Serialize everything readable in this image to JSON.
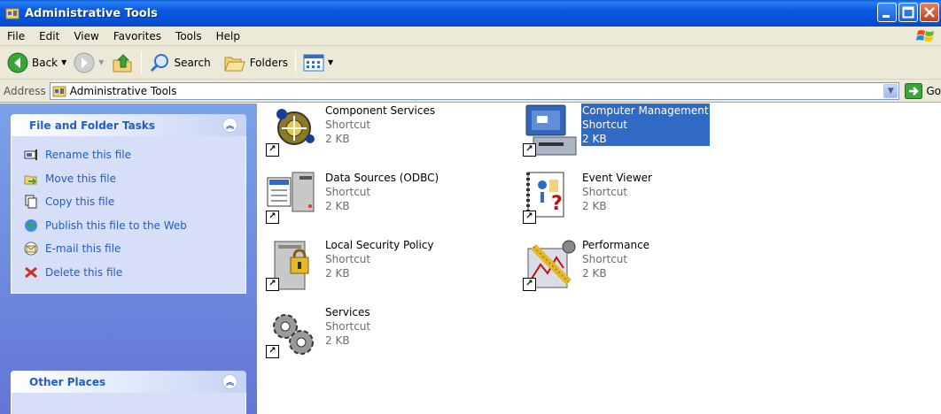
{
  "window": {
    "title": "Administrative Tools",
    "controls": [
      "minimize",
      "maximize",
      "close"
    ]
  },
  "menu": {
    "items": [
      "File",
      "Edit",
      "View",
      "Favorites",
      "Tools",
      "Help"
    ]
  },
  "toolbar": {
    "back_label": "Back",
    "search_label": "Search",
    "folders_label": "Folders"
  },
  "address": {
    "label": "Address",
    "value": "Administrative Tools",
    "go_label": "Go"
  },
  "file_folder_tasks": {
    "title": "File and Folder Tasks",
    "tasks": [
      {
        "label": "Rename this file",
        "icon": "rename-icon"
      },
      {
        "label": "Move this file",
        "icon": "move-icon"
      },
      {
        "label": "Copy this file",
        "icon": "copy-icon"
      },
      {
        "label": "Publish this file to the Web",
        "icon": "publish-web-icon"
      },
      {
        "label": "E-mail this file",
        "icon": "email-icon"
      },
      {
        "label": "Delete this file",
        "icon": "delete-icon"
      }
    ]
  },
  "other_places": {
    "title": "Other Places"
  },
  "files": [
    {
      "name": "Component Services",
      "type": "Shortcut",
      "size": "2 KB",
      "selected": false
    },
    {
      "name": "Computer Management",
      "type": "Shortcut",
      "size": "2 KB",
      "selected": true
    },
    {
      "name": "Data Sources (ODBC)",
      "type": "Shortcut",
      "size": "2 KB",
      "selected": false
    },
    {
      "name": "Event Viewer",
      "type": "Shortcut",
      "size": "2 KB",
      "selected": false
    },
    {
      "name": "Local Security Policy",
      "type": "Shortcut",
      "size": "2 KB",
      "selected": false
    },
    {
      "name": "Performance",
      "type": "Shortcut",
      "size": "2 KB",
      "selected": false
    },
    {
      "name": "Services",
      "type": "Shortcut",
      "size": "2 KB",
      "selected": false
    }
  ],
  "colors": {
    "titlebar": "#0858e0",
    "taskpane": "#7ba2e7",
    "link": "#215dc6",
    "selection": "#316ac5"
  }
}
